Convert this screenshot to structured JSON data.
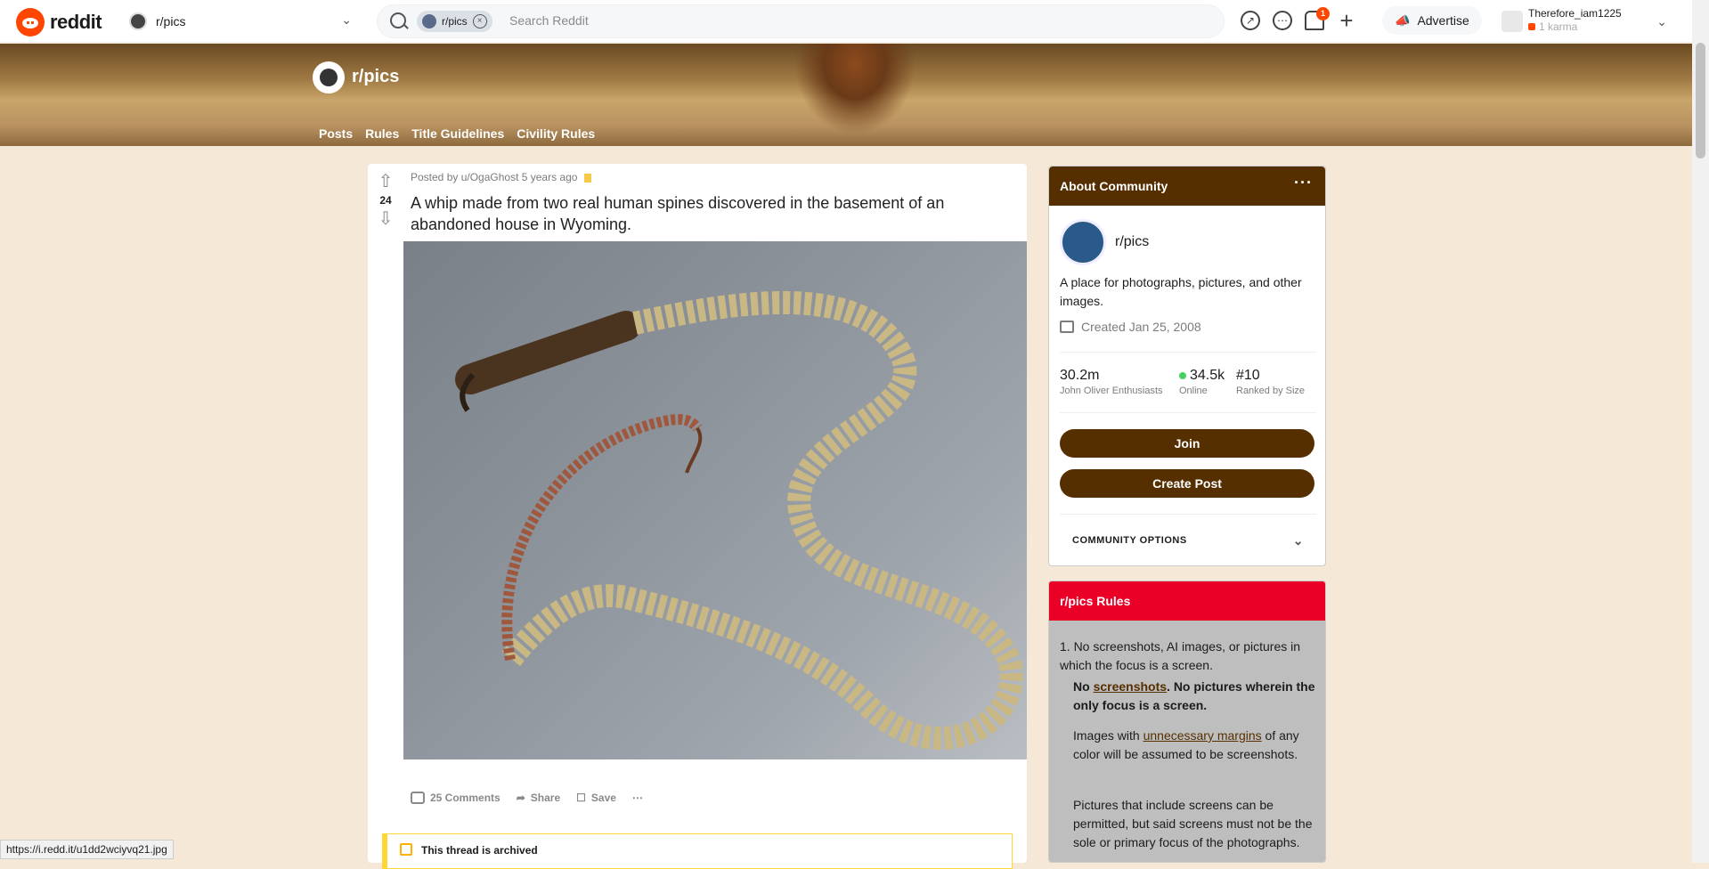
{
  "topbar": {
    "logo_text": "reddit",
    "community": "r/pics",
    "search": {
      "chip_label": "r/pics",
      "placeholder": "Search Reddit"
    },
    "notifications_count": "1",
    "advertise_label": "Advertise",
    "user": {
      "name": "Therefore_iam1225",
      "karma": "1 karma"
    }
  },
  "banner": {
    "title": "r/pics",
    "tabs": [
      "Posts",
      "Rules",
      "Title Guidelines",
      "Civility Rules"
    ]
  },
  "post": {
    "score": "24",
    "meta": "Posted by u/OgaGhost 5 years ago",
    "title": "A whip made from two real human spines discovered in the basement of an abandoned house in Wyoming.",
    "comments": "25 Comments",
    "share": "Share",
    "save": "Save",
    "archived": "This thread is archived"
  },
  "about": {
    "header": "About Community",
    "name": "r/pics",
    "description": "A place for photographs, pictures, and other images.",
    "created": "Created Jan 25, 2008",
    "stats": [
      {
        "value": "30.2m",
        "label": "John Oliver Enthusiasts"
      },
      {
        "value": "34.5k",
        "label": "Online"
      },
      {
        "value": "#10",
        "label": "Ranked by Size"
      }
    ],
    "join_label": "Join",
    "create_post_label": "Create Post",
    "community_options": "COMMUNITY OPTIONS"
  },
  "rules": {
    "header": "r/pics Rules",
    "rule1": "1. No screenshots, AI images, or pictures in which the focus is a screen.",
    "rule1_bold_pre": "No ",
    "rule1_bold_link": "screenshots",
    "rule1_bold_post": ". No pictures wherein the only focus is a screen.",
    "para2_pre": "Images with ",
    "para2_link": "unnecessary margins",
    "para2_post": " of any color will be assumed to be screenshots.",
    "para3": "Pictures that include screens can be permitted, but said screens must not be the sole or primary focus of the photographs."
  },
  "status_url": "https://i.redd.it/u1dd2wciyvq21.jpg",
  "colors": {
    "accent": "#562f00",
    "rules_header": "#ea0027",
    "page_bg": "#f6e8d6",
    "orange": "#ff4500"
  }
}
